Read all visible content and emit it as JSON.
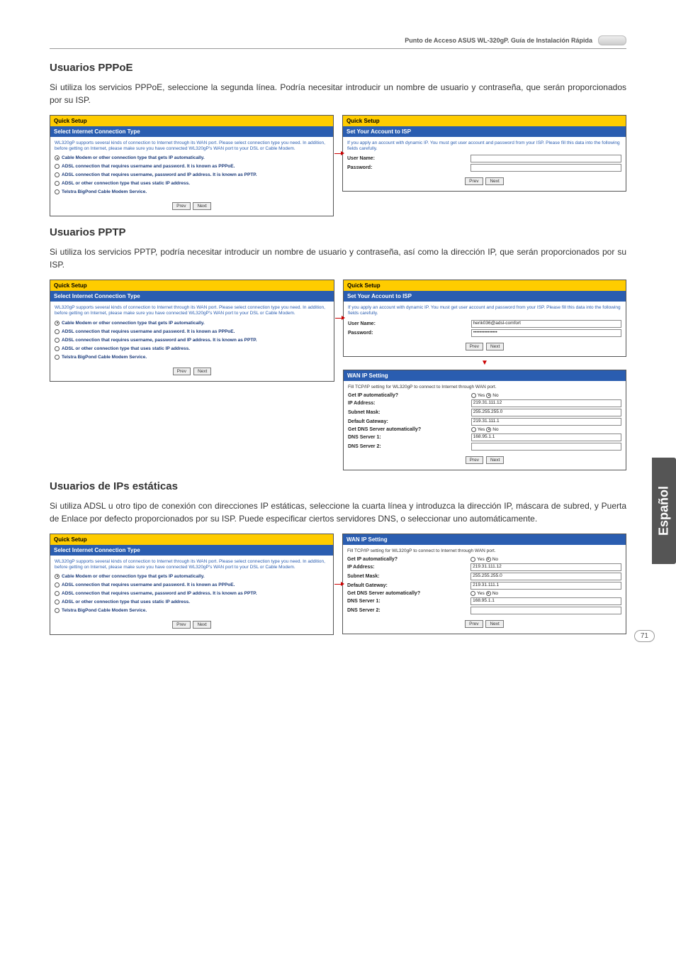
{
  "header": {
    "title": "Punto de Acceso ASUS WL-320gP. Guía de Instalación Rápida"
  },
  "side_tab": "Español",
  "page_number": "71",
  "pppoe": {
    "heading": "Usuarios PPPoE",
    "body": "Si utiliza los servicios PPPoE, seleccione la segunda línea. Podría necesitar introducir un nombre de usuario y contraseña, que serán proporcionados por su ISP."
  },
  "pptp": {
    "heading": "Usuarios PPTP",
    "body": "Si utiliza los servicios PPTP, podría necesitar introducir un nombre de usuario y contraseña, así como la dirección IP, que serán proporcionados por su ISP."
  },
  "static": {
    "heading": "Usuarios de IPs estáticas",
    "body": "Si utiliza ADSL u otro tipo de conexión con direcciones IP estáticas, seleccione la cuarta línea y introduzca la dirección IP, máscara de subred, y Puerta de Enlace por defecto proporcionados por su ISP. Puede especificar ciertos servidores DNS, o seleccionar uno automáticamente."
  },
  "quick_setup": {
    "title": "Quick Setup",
    "conn_type_title": "Select Internet Connection Type",
    "conn_desc": "WL320gP supports several kinds of connection to Internet through its WAN port. Please select connection type you need. In addition, before getting on Internet, please make sure you have connected WL320gP's WAN port to your DSL or Cable Modem.",
    "options": {
      "auto": "Cable Modem or other connection type that gets IP automatically.",
      "pppoe": "ADSL connection that requires username and password. It is known as PPPoE.",
      "pptp": "ADSL connection that requires username, password and IP address. It is known as PPTP.",
      "staticip": "ADSL or other connection type that uses static IP address.",
      "bigpond": "Telstra BigPond Cable Modem Service."
    },
    "prev": "Prev",
    "next": "Next"
  },
  "isp": {
    "title": "Set Your Account to ISP",
    "desc": "If you apply an account with dynamic IP. You must get user account and password from your ISP. Please fill this data into the following fields carefully.",
    "user_label": "User Name:",
    "pass_label": "Password:",
    "user_value": "herik036@adsl-comfort",
    "pass_value": "•••••••••••••••"
  },
  "wan": {
    "title": "WAN IP Setting",
    "desc": "Fill TCP/IP setting for WL320gP to connect to Internet through WAN port.",
    "get_ip": "Get IP automatically?",
    "ip_addr": "IP Address:",
    "subnet": "Subnet Mask:",
    "gateway": "Default Gateway:",
    "get_dns": "Get DNS Server automatically?",
    "dns1": "DNS Server 1:",
    "dns2": "DNS Server 2:",
    "yes": "Yes",
    "no": "No",
    "ip_val": "219.31.111.12",
    "subnet_val": "255.255.255.0",
    "gateway_val": "219.31.111.1",
    "dns1_val": "168.95.1.1"
  }
}
